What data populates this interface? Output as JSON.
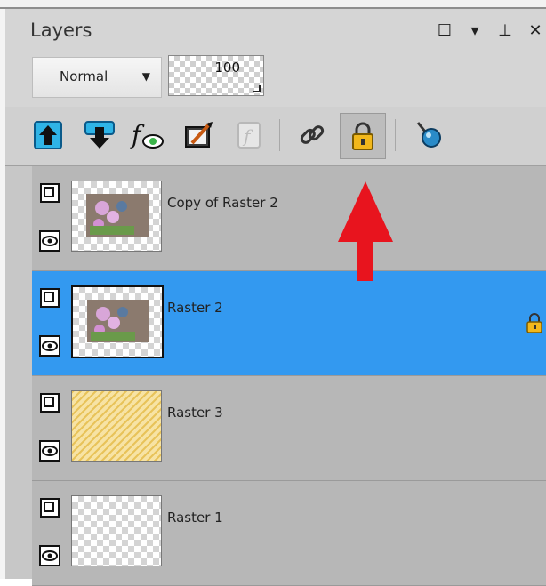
{
  "panel": {
    "title": "Layers"
  },
  "blend_mode": {
    "selected": "Normal"
  },
  "opacity": {
    "value": "100"
  },
  "toolbar": {
    "buttons": [
      {
        "name": "move-layer-up-icon"
      },
      {
        "name": "move-layer-down-icon"
      },
      {
        "name": "layer-effects-icon"
      },
      {
        "name": "adjustment-layer-icon"
      },
      {
        "name": "script-icon"
      },
      {
        "name": "link-layers-icon"
      },
      {
        "name": "lock-transparency-icon"
      },
      {
        "name": "layer-tool-icon"
      }
    ]
  },
  "layers": [
    {
      "name": "Copy of Raster 2",
      "selected": false,
      "locked": false
    },
    {
      "name": "Raster 2",
      "selected": true,
      "locked": true
    },
    {
      "name": "Raster 3",
      "selected": false,
      "locked": false
    },
    {
      "name": "Raster 1",
      "selected": false,
      "locked": false
    }
  ],
  "colors": {
    "selection": "#3399f0",
    "annotation_arrow": "#e8141e"
  }
}
